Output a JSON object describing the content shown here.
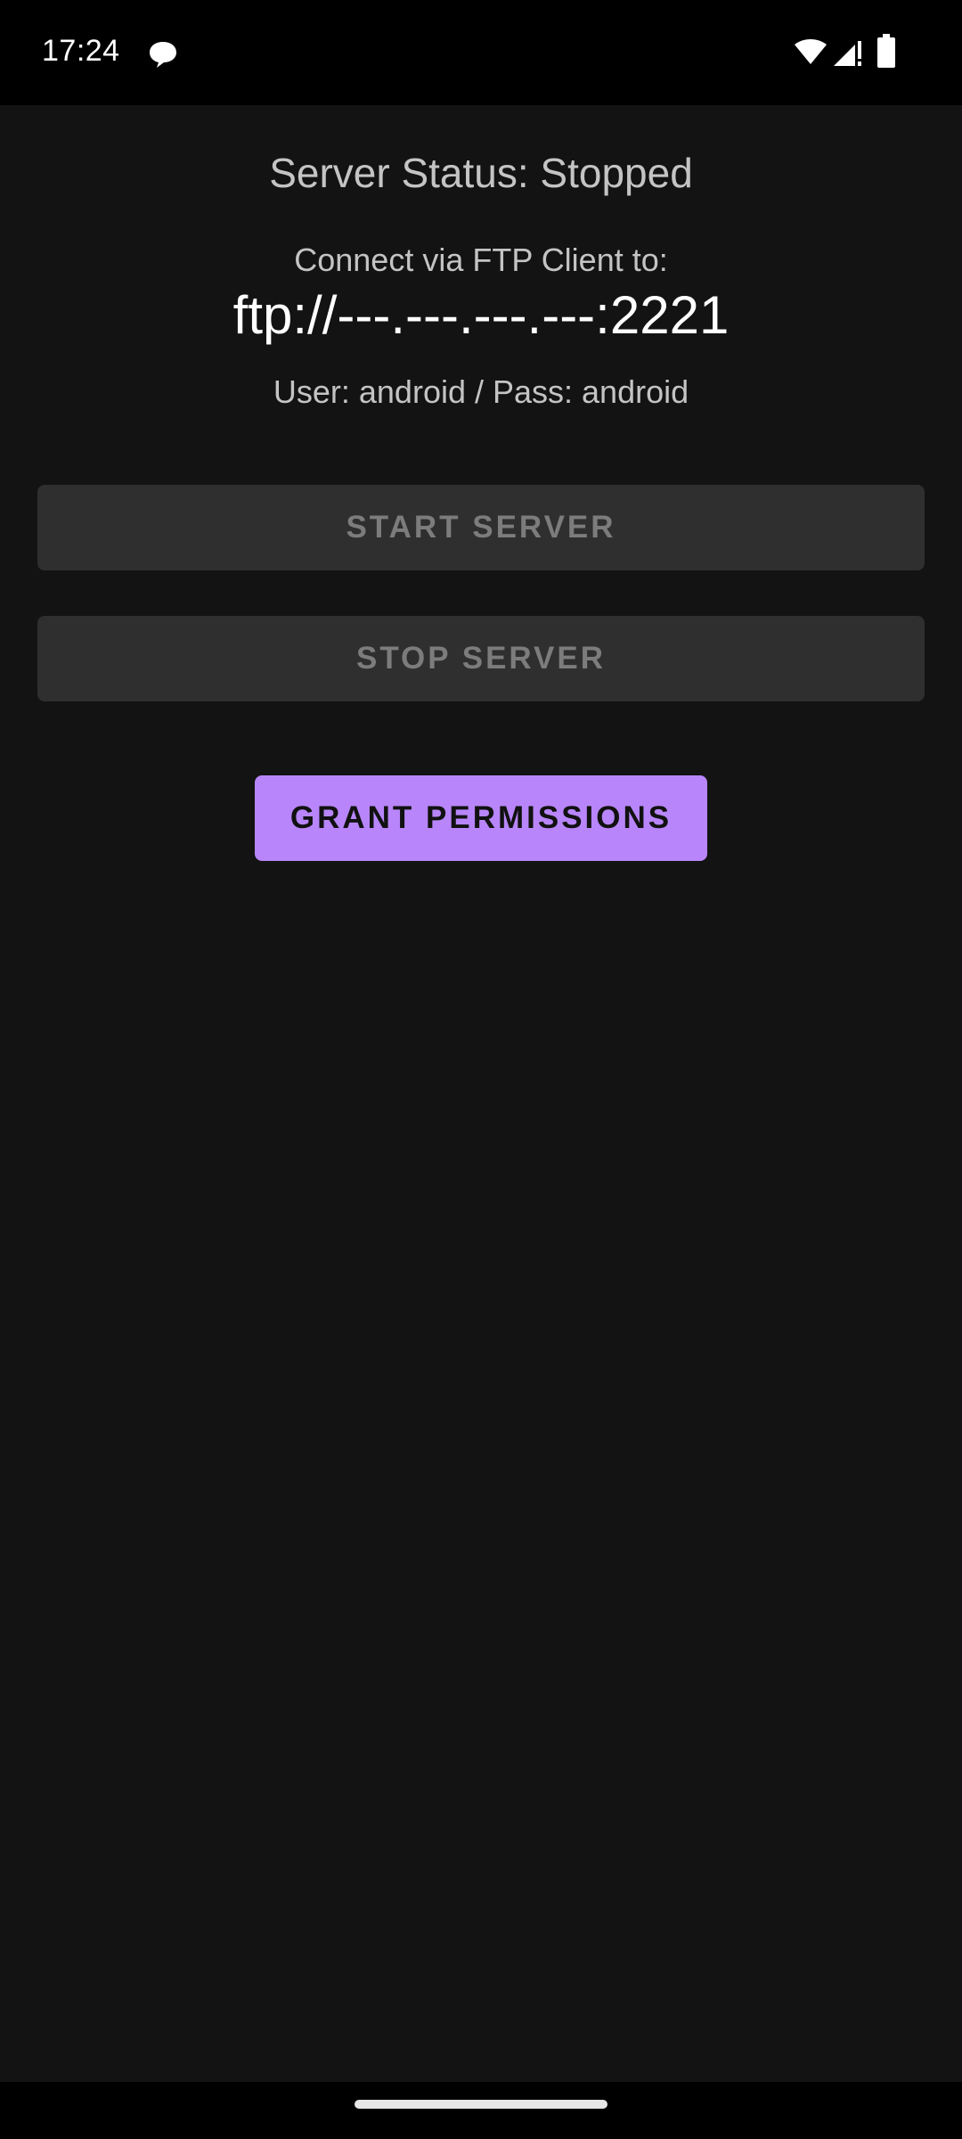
{
  "status_bar": {
    "time": "17:24",
    "notification_icon": "message-bubble-icon",
    "wifi_icon": "wifi-icon",
    "signal_icon": "cellular-signal-no-data-icon",
    "battery_icon": "battery-icon"
  },
  "server": {
    "status_text": "Server Status: Stopped",
    "connect_label": "Connect via FTP Client to:",
    "url": "ftp://---.---.---.---:2221",
    "credentials": "User: android / Pass: android"
  },
  "buttons": {
    "start_label": "START SERVER",
    "stop_label": "STOP SERVER",
    "grant_label": "GRANT PERMISSIONS"
  },
  "colors": {
    "background": "#131313",
    "disabled_button": "#2f2f2f",
    "accent": "#b886fa"
  }
}
